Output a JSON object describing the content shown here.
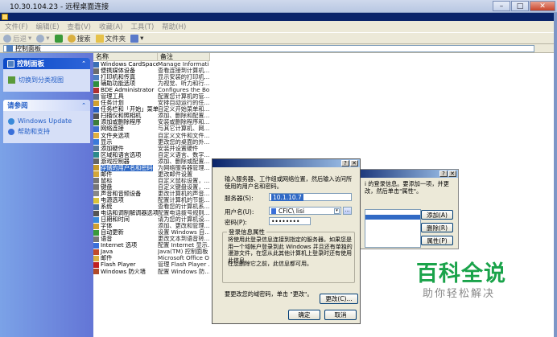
{
  "rdp_title": "10.30.104.23 - 远程桌面连接",
  "menu": [
    "文件(F)",
    "编辑(E)",
    "查看(V)",
    "收藏(A)",
    "工具(T)",
    "帮助(H)"
  ],
  "toolbar": {
    "back": "后退",
    "search": "搜索",
    "folders": "文件夹"
  },
  "address": "控制面板",
  "taskpane": {
    "control_panel": {
      "title": "控制面板",
      "link": "切换到分类视图"
    },
    "see_also": {
      "title": "请参阅",
      "links": [
        "Windows Update",
        "帮助和支持"
      ]
    }
  },
  "columns": {
    "name": "名称",
    "comment": "备注"
  },
  "items": [
    {
      "name": "Windows CardSpace",
      "desc": "Manage Informatio...",
      "color": "#3a6fb5"
    },
    {
      "name": "便携媒体设备",
      "desc": "查看连接到计算机...",
      "color": "#6d6d6d"
    },
    {
      "name": "打印机和传真",
      "desc": "显示安装的打印机...",
      "color": "#4f7fc0"
    },
    {
      "name": "辅助功能选项",
      "desc": "为视觉、听力和行...",
      "color": "#2f8f3f"
    },
    {
      "name": "BDE Administrator",
      "desc": "Configures the Borl...",
      "color": "#b03030"
    },
    {
      "name": "管理工具",
      "desc": "配置您计算机的管...",
      "color": "#5c6e8a"
    },
    {
      "name": "任务计划",
      "desc": "安排自动运行的任...",
      "color": "#d0a030"
    },
    {
      "name": "任务栏和「开始」菜单",
      "desc": "自定义开始菜单和...",
      "color": "#2a5fbf"
    },
    {
      "name": "扫描仪和照相机",
      "desc": "添加、删除和配置...",
      "color": "#555"
    },
    {
      "name": "添加或删除程序",
      "desc": "安装或删除程序和...",
      "color": "#3c7d3c"
    },
    {
      "name": "网络连接",
      "desc": "与其它计算机、网...",
      "color": "#3d6fcf"
    },
    {
      "name": "文件夹选项",
      "desc": "自定义文件和文件...",
      "color": "#e0b040"
    },
    {
      "name": "显示",
      "desc": "更改您的桌面的外...",
      "color": "#3a7ad9"
    },
    {
      "name": "添加硬件",
      "desc": "安装并设置硬件",
      "color": "#5a7a9a"
    },
    {
      "name": "区域和语言选项",
      "desc": "自定义语言、数字...",
      "color": "#2c8a8a"
    },
    {
      "name": "游戏控制器",
      "desc": "添加、删除或配置...",
      "color": "#666"
    },
    {
      "name": "存储的用户名和密码",
      "desc": "为网络服务器管理...",
      "color": "#c79a2a",
      "selected": true
    },
    {
      "name": "邮件",
      "desc": "更改邮件设置",
      "color": "#d4a73a"
    },
    {
      "name": "鼠标",
      "desc": "自定义鼠标设置，...",
      "color": "#777"
    },
    {
      "name": "键盘",
      "desc": "自定义键盘设置，...",
      "color": "#777"
    },
    {
      "name": "声音和音频设备",
      "desc": "更改计算机的声音...",
      "color": "#888"
    },
    {
      "name": "电源选项",
      "desc": "配置计算机的节能...",
      "color": "#d9c33a"
    },
    {
      "name": "系统",
      "desc": "查看您的计算机系...",
      "color": "#4a6fa5"
    },
    {
      "name": "电话和调制解调器选项",
      "desc": "配置电话拨号规则...",
      "color": "#555"
    },
    {
      "name": "日期和时间",
      "desc": "请为您的计算机设...",
      "color": "#3a8ad9"
    },
    {
      "name": "字体",
      "desc": "添加、更改和管理...",
      "color": "#d0a030"
    },
    {
      "name": "自动更新",
      "desc": "设置 Windows 自...",
      "color": "#3a9a3a"
    },
    {
      "name": "语音",
      "desc": "更改文本到语音转...",
      "color": "#777"
    },
    {
      "name": "Internet 选项",
      "desc": "配置 Internet 显示...",
      "color": "#3a6fd9"
    },
    {
      "name": "Java",
      "desc": "Java(TM) 控制面板",
      "color": "#c04a2a"
    },
    {
      "name": "邮件",
      "desc": "Microsoft Office Ou...",
      "color": "#d9b040"
    },
    {
      "name": "Flash Player",
      "desc": "管理 Flash Player ...",
      "color": "#c02020"
    },
    {
      "name": "Windows 防火墙",
      "desc": "配置 Windows 防...",
      "color": "#b04a2a"
    }
  ],
  "back_dialog": {
    "text": "i 的登录信息。要添加一项，并更改，然后单击\"属性\"。",
    "buttons": [
      "添加(A)",
      "删除(R)",
      "属性(P)"
    ]
  },
  "dialog": {
    "intro": "输入服务器、工作组或网络位置，然后输入访问所使用的用户名和密码。",
    "server_label": "服务器(S):",
    "server_value": "10.1.10.7",
    "user_label": "用户名(U):",
    "user_value": "CFIC\\ lisi",
    "password_label": "密码(P):",
    "password_value": "••••••••",
    "group_title": "登录信息属性",
    "group_text": "将使用此登录信息连接到指定的服务器。如果您是用一个域帐户登录到此 Windows 并且还有单独的漫游文件，在您从此其他计算机上登录时还有使用此信息。",
    "group_text2": "在您删除它之前，此信息都可用。",
    "note": "要更改您的域密码，单击 \"更改\"。",
    "change_btn": "更改(C)...",
    "ok_btn": "确定",
    "cancel_btn": "取消"
  },
  "watermark": {
    "big": "百科全说",
    "small": "助你轻松解决"
  }
}
